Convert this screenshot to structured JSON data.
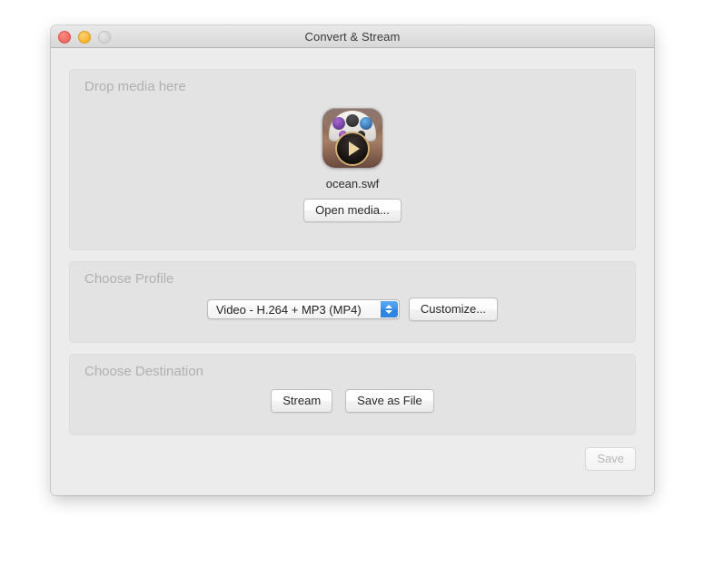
{
  "window": {
    "title": "Convert & Stream",
    "traffic_lights": [
      {
        "name": "close",
        "color": "#ef6a60"
      },
      {
        "name": "minimize",
        "color": "#f7b52c"
      },
      {
        "name": "zoom",
        "color": "#d3d3d3"
      }
    ]
  },
  "media_panel": {
    "title": "Drop media here",
    "icon": "vlc-media-file-icon",
    "file_name": "ocean.swf",
    "open_media_label": "Open media..."
  },
  "profile_panel": {
    "title": "Choose Profile",
    "selected_profile": "Video - H.264 + MP3 (MP4)",
    "stepper_icon": "chevron-up-down-icon",
    "customize_label": "Customize...",
    "accent_color": "#3d93ec"
  },
  "destination_panel": {
    "title": "Choose Destination",
    "stream_label": "Stream",
    "save_as_file_label": "Save as File"
  },
  "footer": {
    "save_label": "Save",
    "save_enabled": false
  }
}
